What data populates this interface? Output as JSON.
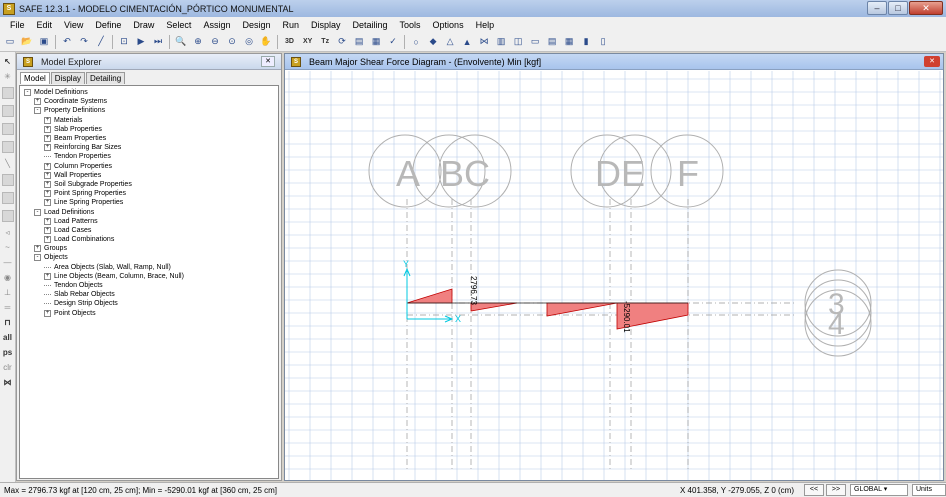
{
  "window": {
    "title": "SAFE 12.3.1 - MODELO CIMENTACIÓN_PÓRTICO MONUMENTAL"
  },
  "menu": [
    "File",
    "Edit",
    "View",
    "Define",
    "Draw",
    "Select",
    "Assign",
    "Design",
    "Run",
    "Display",
    "Detailing",
    "Tools",
    "Options",
    "Help"
  ],
  "toolbar": {
    "label_3d": "3D",
    "label_xy": "XY",
    "label_tz": "Tz"
  },
  "left_toolbar": {
    "all": "all",
    "ps": "ps",
    "clr": "clr"
  },
  "explorer": {
    "title": "Model Explorer",
    "tabs": [
      "Model",
      "Display",
      "Detailing"
    ],
    "tree": [
      {
        "label": "Model Definitions",
        "level": 0,
        "expander": "-"
      },
      {
        "label": "Coordinate Systems",
        "level": 1,
        "expander": "+"
      },
      {
        "label": "Property Definitions",
        "level": 1,
        "expander": "-"
      },
      {
        "label": "Materials",
        "level": 2,
        "expander": "+"
      },
      {
        "label": "Slab Properties",
        "level": 2,
        "expander": "+"
      },
      {
        "label": "Beam Properties",
        "level": 2,
        "expander": "+"
      },
      {
        "label": "Reinforcing Bar Sizes",
        "level": 2,
        "expander": "+"
      },
      {
        "label": "Tendon Properties",
        "level": 2,
        "expander": ""
      },
      {
        "label": "Column Properties",
        "level": 2,
        "expander": "+"
      },
      {
        "label": "Wall Properties",
        "level": 2,
        "expander": "+"
      },
      {
        "label": "Soil Subgrade Properties",
        "level": 2,
        "expander": "+"
      },
      {
        "label": "Point Spring Properties",
        "level": 2,
        "expander": "+"
      },
      {
        "label": "Line Spring Properties",
        "level": 2,
        "expander": "+"
      },
      {
        "label": "Load Definitions",
        "level": 1,
        "expander": "-"
      },
      {
        "label": "Load Patterns",
        "level": 2,
        "expander": "+"
      },
      {
        "label": "Load Cases",
        "level": 2,
        "expander": "+"
      },
      {
        "label": "Load Combinations",
        "level": 2,
        "expander": "+"
      },
      {
        "label": "Groups",
        "level": 1,
        "expander": "+"
      },
      {
        "label": "Objects",
        "level": 1,
        "expander": "-"
      },
      {
        "label": "Area Objects (Slab, Wall, Ramp, Null)",
        "level": 2,
        "expander": ""
      },
      {
        "label": "Line Objects (Beam, Column, Brace, Null)",
        "level": 2,
        "expander": "+"
      },
      {
        "label": "Tendon Objects",
        "level": 2,
        "expander": ""
      },
      {
        "label": "Slab Rebar Objects",
        "level": 2,
        "expander": ""
      },
      {
        "label": "Design Strip Objects",
        "level": 2,
        "expander": ""
      },
      {
        "label": "Point Objects",
        "level": 2,
        "expander": "+"
      }
    ]
  },
  "diagram": {
    "title": "Beam Major Shear Force Diagram - (Envolvente)  Min  [kgf]",
    "grid_labels": [
      "A",
      "BC",
      "DE",
      "F"
    ],
    "row_label": "3",
    "row_label_2": "4",
    "axis_x": "X",
    "axis_y": "Y",
    "max_value_label": "2796.73",
    "min_value_label": "-5290.01",
    "fill_color": "#f08080",
    "outline_color": "#c00000"
  },
  "status": {
    "message": "Max = 2796.73 kgf at [120 cm, 25 cm];  Min = -5290.01 kgf at [360 cm, 25 cm]",
    "coords": "X 401.358,  Y -279.055,  Z 0  (cm)",
    "nav_prev": "<<",
    "nav_next": ">>",
    "coord_system": "GLOBAL",
    "units": "Units"
  }
}
